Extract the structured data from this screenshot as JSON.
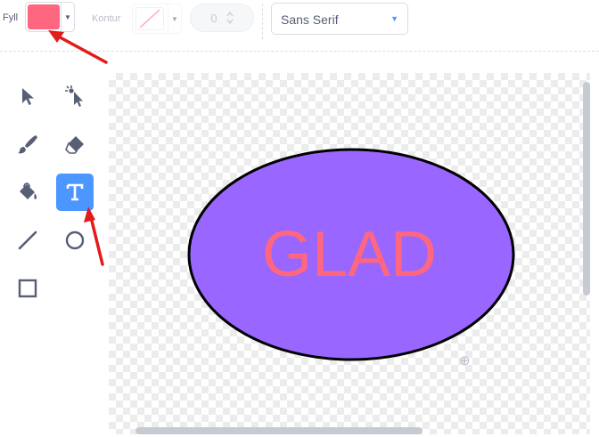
{
  "toolbar": {
    "fill_label": "Fyll",
    "fill_color": "#ff6680",
    "outline_label": "Kontur",
    "outline_width_value": "0",
    "font_select_value": "Sans Serif"
  },
  "tools": [
    {
      "name": "select-tool",
      "icon": "arrow-pointer-icon",
      "active": false
    },
    {
      "name": "reshape-tool",
      "icon": "reshape-pointer-icon",
      "active": false
    },
    {
      "name": "brush-tool",
      "icon": "brush-icon",
      "active": false
    },
    {
      "name": "eraser-tool",
      "icon": "eraser-icon",
      "active": false
    },
    {
      "name": "fill-tool",
      "icon": "paint-bucket-icon",
      "active": false
    },
    {
      "name": "text-tool",
      "icon": "text-t-icon",
      "active": true
    },
    {
      "name": "line-tool",
      "icon": "line-icon",
      "active": false
    },
    {
      "name": "circle-tool",
      "icon": "circle-icon",
      "active": false
    },
    {
      "name": "rectangle-tool",
      "icon": "square-icon",
      "active": false
    }
  ],
  "canvas": {
    "ellipse_fill": "#9966ff",
    "ellipse_stroke": "#000000",
    "text": "GLAD",
    "text_color": "#ff6680"
  },
  "colors": {
    "accent": "#4c97ff",
    "annotation_arrow": "#e21b1b"
  }
}
